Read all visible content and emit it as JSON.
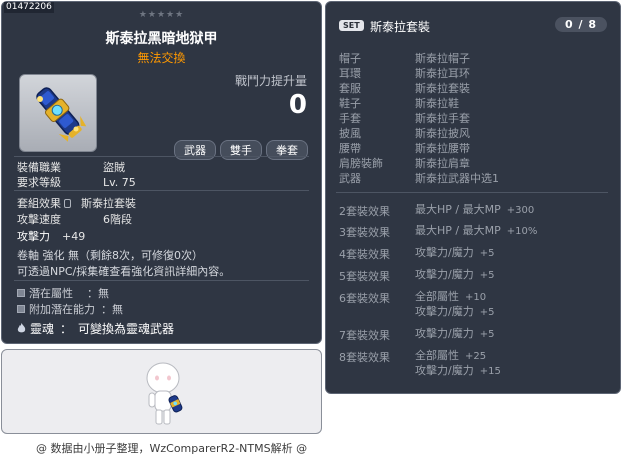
{
  "item": {
    "id": "01472206",
    "stars": "★★★★★",
    "name": "斯泰拉黑暗地狱甲",
    "trade_status": "無法交換",
    "power_label": "戰鬥力提升量",
    "power_value": "0",
    "tags": [
      "武器",
      "雙手",
      "拳套"
    ],
    "job_label": "裝備職業",
    "job_value": "盜賊",
    "level_label": "要求等級",
    "level_value": "Lv. 75",
    "set_label": "套組效果",
    "set_value": "斯泰拉套裝",
    "speed_label": "攻擊速度",
    "speed_value": "6階段",
    "attack_label": "攻擊力",
    "attack_value": "+49",
    "scroll_line": "卷軸 強化 無（剩餘8次，可修復0次）",
    "npc_line": "可透過NPC/採集確查看強化資訊詳細內容。",
    "potential_label": "潛在屬性",
    "potential_value": "無",
    "additional_label": "附加潛在能力",
    "additional_value": "無",
    "soul_label": "靈魂",
    "soul_value": "可變換為靈魂武器",
    "colors": {
      "trade": "#ff9900",
      "panel": "#2f3643"
    }
  },
  "footer": "@ 数据由小册子整理，WzComparerR2-NTMS解析 @",
  "set": {
    "badge": "SET",
    "title": "斯泰拉套裝",
    "count": "0 / 8",
    "parts": [
      {
        "slot": "帽子",
        "name": "斯泰拉帽子"
      },
      {
        "slot": "耳環",
        "name": "斯泰拉耳环"
      },
      {
        "slot": "套服",
        "name": "斯泰拉套裝"
      },
      {
        "slot": "鞋子",
        "name": "斯泰拉鞋"
      },
      {
        "slot": "手套",
        "name": "斯泰拉手套"
      },
      {
        "slot": "披風",
        "name": "斯泰拉披风"
      },
      {
        "slot": "腰帶",
        "name": "斯泰拉腰带"
      },
      {
        "slot": "肩膀裝飾",
        "name": "斯泰拉肩章"
      },
      {
        "slot": "武器",
        "name": "斯泰拉武器中选1"
      }
    ],
    "bonuses": [
      {
        "label": "2套裝效果",
        "lines": [
          {
            "text": "最大HP / 最大MP",
            "num": "+300"
          }
        ]
      },
      {
        "label": "3套裝效果",
        "lines": [
          {
            "text": "最大HP / 最大MP",
            "num": "+10%"
          }
        ]
      },
      {
        "label": "4套裝效果",
        "lines": [
          {
            "text": "攻擊力/魔力",
            "num": "+5"
          }
        ]
      },
      {
        "label": "5套裝效果",
        "lines": [
          {
            "text": "攻擊力/魔力",
            "num": "+5"
          }
        ]
      },
      {
        "label": "6套裝效果",
        "lines": [
          {
            "text": "全部屬性",
            "num": "+10"
          },
          {
            "text": "攻擊力/魔力",
            "num": "+5"
          }
        ]
      },
      {
        "label": "7套裝效果",
        "lines": [
          {
            "text": "攻擊力/魔力",
            "num": "+5"
          }
        ]
      },
      {
        "label": "8套裝效果",
        "lines": [
          {
            "text": "全部屬性",
            "num": "+25"
          },
          {
            "text": "攻擊力/魔力",
            "num": "+15"
          }
        ]
      }
    ]
  }
}
